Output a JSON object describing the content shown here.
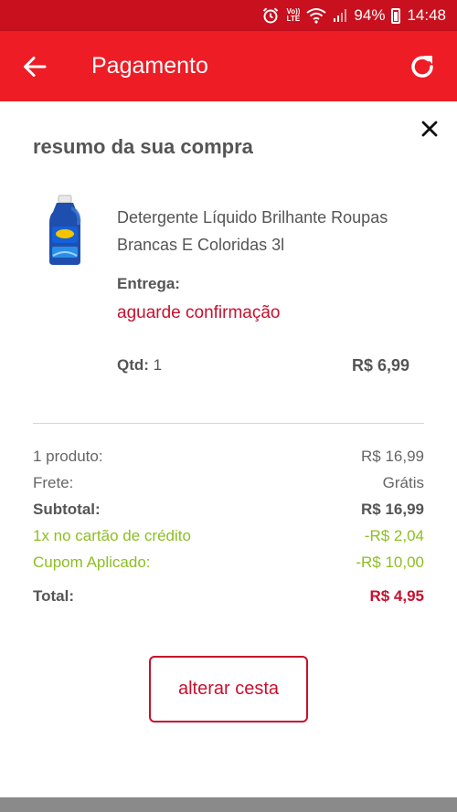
{
  "status_bar": {
    "alarm_icon": "alarm-clock-icon",
    "volte_top": "Vo))",
    "volte_bottom": "LTE",
    "battery_percent": "94%",
    "time": "14:48"
  },
  "app_bar": {
    "title": "Pagamento",
    "back_icon": "arrow-left-icon",
    "refresh_icon": "refresh-icon",
    "background_color": "#ee1c25"
  },
  "sheet": {
    "title": "resumo da sua compra",
    "close_icon": "close-icon",
    "product": {
      "name": "Detergente Líquido Brilhante Roupas Brancas E Coloridas 3l",
      "delivery_label": "Entrega:",
      "delivery_status": "aguarde confirmação",
      "qty_label": "Qtd:",
      "qty_value": "1",
      "price": "R$ 6,99"
    },
    "summary": {
      "products_label": "1 produto:",
      "products_value": "R$ 16,99",
      "shipping_label": "Frete:",
      "shipping_value": "Grátis",
      "subtotal_label": "Subtotal:",
      "subtotal_value": "R$ 16,99",
      "card_discount_label": "1x no cartão de crédito",
      "card_discount_value": "-R$ 2,04",
      "coupon_label": "Cupom Aplicado:",
      "coupon_value": "-R$ 10,00",
      "total_label": "Total:",
      "total_value": "R$ 4,95"
    },
    "alter_button": "alterar cesta"
  },
  "colors": {
    "brand_red": "#ee1c25",
    "accent_red": "#c8102e",
    "discount_green": "#8dbf21"
  }
}
